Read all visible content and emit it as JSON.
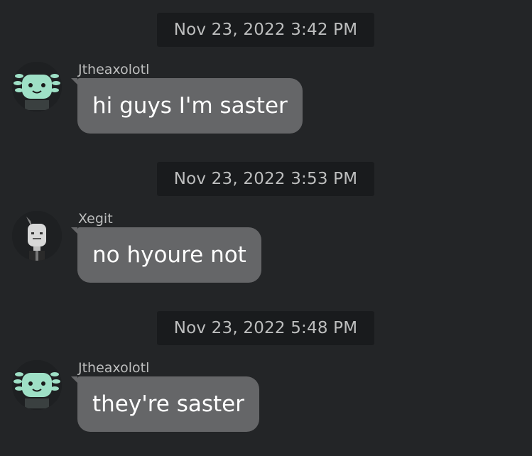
{
  "messages": [
    {
      "timestamp": "Nov 23, 2022 3:42 PM",
      "username": "Jtheaxolotl",
      "avatar_icon": "axolotl-avatar-icon",
      "text": "hi guys I'm saster"
    },
    {
      "timestamp": "Nov 23, 2022 3:53 PM",
      "username": "Xegit",
      "avatar_icon": "robot-avatar-icon",
      "text": "no hyoure not"
    },
    {
      "timestamp": "Nov 23, 2022 5:48 PM",
      "username": "Jtheaxolotl",
      "avatar_icon": "axolotl-avatar-icon",
      "text": "they're saster"
    }
  ],
  "colors": {
    "background": "#232527",
    "timestamp_bg": "#191b1d",
    "bubble_bg": "#656668",
    "text_primary": "#ffffff",
    "text_secondary": "#bdbebe",
    "axolotl_skin": "#9ee0c6"
  }
}
